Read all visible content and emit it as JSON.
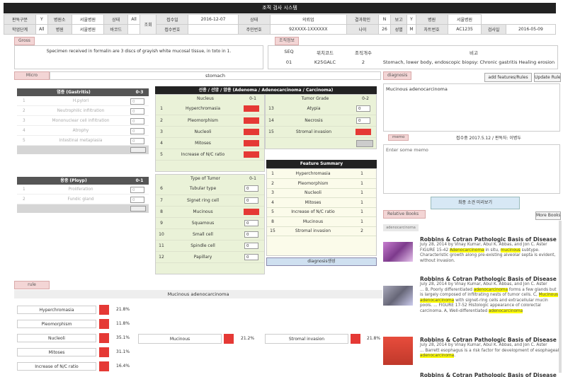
{
  "title": "조직 검사 시스템",
  "header": {
    "row1": [
      "판독구분",
      "Y",
      "병원소",
      "서울병원",
      "상태",
      "All",
      "조회",
      "접수일",
      "2016-12-07",
      "상태",
      "의뢰업",
      "결과확인",
      "N",
      "보고",
      "Y",
      "병원",
      "서울병원"
    ],
    "row2": [
      "학업단계",
      "All",
      "병원",
      "서울병원",
      "바코드",
      "",
      "접수번호",
      "",
      "주민번호",
      "92XXXX-1XXXXXX",
      "나이",
      "26",
      "성별",
      "M",
      "차트번호",
      "AC1235",
      "검사일",
      "2016-05-09"
    ]
  },
  "gross": {
    "tab": "Gross",
    "text": "Specimen received in formalin are 3 discs of grayish white mucosal tissue, in toto in 1."
  },
  "tissue_info": {
    "tab": "조직정보",
    "headers": [
      "SEQ",
      "위치코드",
      "조직개수",
      "비고"
    ],
    "row": [
      "01",
      "K25GALC",
      "2",
      "Stomach, lower body, endoscopic biopsy: Chronic gastritis Healing erosion"
    ]
  },
  "micro": {
    "tab": "Micro",
    "value": "stomach"
  },
  "diagnosis": {
    "tab": "diagnosis",
    "add_btn": "add features/Rules",
    "update_btn": "Update Rules",
    "text": "Mucinous adenocarcinoma"
  },
  "memo": {
    "tab": "memo",
    "info": "접수중 2017.5.12 / 판독자: 이병두",
    "placeholder": "Enter some memo"
  },
  "preview_btn": "최종 소견 미리보기",
  "gastritis": {
    "title": "염증 (Gastritis)",
    "range": "0-3",
    "items": [
      {
        "n": "1",
        "label": "H.pylori",
        "v": "0"
      },
      {
        "n": "2",
        "label": "Neutrophilic infiltration",
        "v": "0"
      },
      {
        "n": "3",
        "label": "Mononuclear cell infiltration",
        "v": "0"
      },
      {
        "n": "4",
        "label": "Atrophy",
        "v": "0"
      },
      {
        "n": "5",
        "label": "Intestinal metaplasia",
        "v": "0"
      }
    ]
  },
  "polyp": {
    "title": "용종 (Ployp)",
    "range": "0-1",
    "items": [
      {
        "n": "1",
        "label": "Proliferation",
        "v": "0"
      },
      {
        "n": "2",
        "label": "Fundic gland",
        "v": "0"
      }
    ]
  },
  "adenoma": {
    "title": "선종 / 선암 / 암종 (Adenoma / Adenocarcinoma / Carcinoma)",
    "nucleus": {
      "title": "Nucleus",
      "range": "0-1",
      "items": [
        {
          "n": "1",
          "label": "Hyperchromasia",
          "red": true
        },
        {
          "n": "2",
          "label": "Pleomorphism",
          "red": true
        },
        {
          "n": "3",
          "label": "Nucleoli",
          "red": true
        },
        {
          "n": "4",
          "label": "Mitoses",
          "red": true
        },
        {
          "n": "5",
          "label": "Increase of N/C ratio",
          "red": true
        }
      ]
    },
    "grade": {
      "title": "Tumor Grade",
      "range": "0-2",
      "items": [
        {
          "n": "13",
          "label": "Atypia",
          "v": "0"
        },
        {
          "n": "14",
          "label": "Necrosis",
          "v": "0"
        },
        {
          "n": "15",
          "label": "Stromal invasion",
          "red": true
        }
      ]
    },
    "type": {
      "title": "Type of Tumor",
      "range": "0-1",
      "items": [
        {
          "n": "6",
          "label": "Tubular type",
          "v": "0"
        },
        {
          "n": "7",
          "label": "Signet ring cell",
          "v": "0"
        },
        {
          "n": "8",
          "label": "Mucinous",
          "red": true
        },
        {
          "n": "9",
          "label": "Squamous",
          "v": "0"
        },
        {
          "n": "10",
          "label": "Small cell",
          "v": "0"
        },
        {
          "n": "11",
          "label": "Spindle cell",
          "v": "0"
        },
        {
          "n": "12",
          "label": "Papillary",
          "v": "0"
        }
      ]
    }
  },
  "feature_summary": {
    "title": "Feature Summary",
    "items": [
      {
        "n": "1",
        "label": "Hyperchromasia",
        "v": "1"
      },
      {
        "n": "2",
        "label": "Pleomorphism",
        "v": "1"
      },
      {
        "n": "3",
        "label": "Nucleoli",
        "v": "1"
      },
      {
        "n": "4",
        "label": "Mitoses",
        "v": "1"
      },
      {
        "n": "5",
        "label": "Increase of N/C ratio",
        "v": "1"
      },
      {
        "n": "8",
        "label": "Mucinous",
        "v": "1"
      },
      {
        "n": "15",
        "label": "Stromal invasion",
        "v": "2"
      }
    ],
    "btn": "diagnosis생성"
  },
  "rule": {
    "tab": "rule",
    "title": "Mucinous adenocarcinoma",
    "col1": [
      {
        "label": "Hyperchromasia",
        "pct": "21.8%"
      },
      {
        "label": "Pleomorphism",
        "pct": "11.8%"
      },
      {
        "label": "Nucleoli",
        "pct": "35.1%"
      },
      {
        "label": "Mitoses",
        "pct": "31.1%"
      },
      {
        "label": "Increase of N/C ratio",
        "pct": "16.4%"
      }
    ],
    "col2": {
      "label": "Mucinous",
      "pct": "21.2%"
    },
    "col3": {
      "label": "Stromal invasion",
      "pct": "21.8%"
    }
  },
  "books": {
    "tab": "Relative Books",
    "more": "More Books",
    "keyword": "adenocarcinoma",
    "items": [
      {
        "title": "Robbins & Cotran Pathologic Basis of Disease",
        "line": "July 28, 2014 by Vinay Kumar, Abul K. Abbas, and Jon C. Aster",
        "seg": [
          "FIGURE 15-42 ",
          "Adenocarcinoma",
          " in situ, ",
          "mucinous",
          " subtype. Characteristic growth along pre-existing alveolar septa is evident, without invasion."
        ]
      },
      {
        "title": "Robbins & Cotran Pathologic Basis of Disease",
        "line": "July 28, 2014 by Vinay Kumar, Abul K. Abbas, and Jon C. Aster",
        "seg": [
          "... B, Poorly differentiated ",
          "adenocarcinoma",
          " forms a few glands but is largely composed of infiltrating nests of tumor cells. C, ",
          "Mucinous",
          " ",
          "adenocarcinoma",
          " with signet-ring cells and extracellular mucin pools. ... FIGURE 17-52 Histologic appearance of colorectal carcinoma. A, Well-differentiated ",
          "adenocarcinoma"
        ]
      },
      {
        "title": "Robbins & Cotran Pathologic Basis of Disease",
        "line": "July 28, 2014 by Vinay Kumar, Abul K. Abbas, and Jon C. Aster",
        "seg": [
          "... Barrett esophagus is a risk factor for development of esophageal ",
          "adenocarcinoma",
          "."
        ]
      },
      {
        "title": "Robbins & Cotran Pathologic Basis of Disease"
      }
    ]
  },
  "colors": {
    "accent_red": "#e53935",
    "panel_green": "#eaf2d8",
    "highlight": "#ffff00",
    "tab_pink": "#f3d5d5"
  }
}
